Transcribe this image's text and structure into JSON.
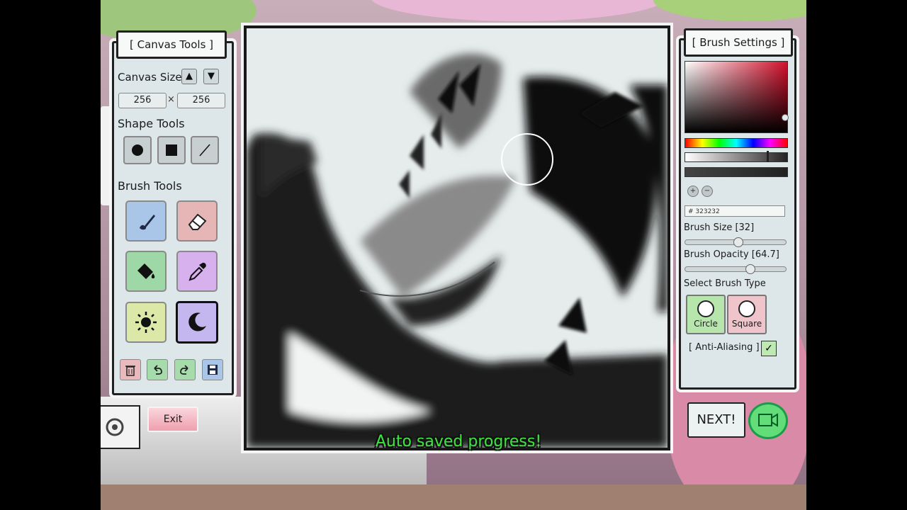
{
  "canvas_tools": {
    "title": "[ Canvas Tools ]",
    "canvas_size_label": "Canvas Size",
    "width": "256",
    "height": "256",
    "times": "×",
    "shape_tools_label": "Shape Tools",
    "shapes": [
      "circle-icon",
      "square-icon",
      "line-icon"
    ],
    "brush_tools_label": "Brush Tools",
    "tools": [
      {
        "name": "brush-icon",
        "color": "#a9c6e8"
      },
      {
        "name": "eraser-icon",
        "color": "#e6b6b7"
      },
      {
        "name": "bucket-icon",
        "color": "#9ed8a6"
      },
      {
        "name": "eyedropper-icon",
        "color": "#d7b0ee"
      },
      {
        "name": "brighten-icon",
        "color": "#dbe8a8"
      },
      {
        "name": "darken-icon",
        "color": "#c4b6ef",
        "selected": true
      }
    ],
    "actions": [
      {
        "name": "trash-icon",
        "color": "#eab9be"
      },
      {
        "name": "undo-icon",
        "color": "#a6dcab"
      },
      {
        "name": "redo-icon",
        "color": "#a6dcab"
      },
      {
        "name": "save-icon",
        "color": "#a9c6e8"
      }
    ]
  },
  "brush_settings": {
    "title": "[ Brush Settings ]",
    "hex_value": "# 323232",
    "brush_size_label": "Brush Size [32]",
    "brush_opacity_label": "Brush Opacity [64.7]",
    "select_type_label": "Select Brush Type",
    "types": [
      {
        "label": "Circle",
        "color": "#b7e6ad"
      },
      {
        "label": "Square",
        "color": "#efc5cb"
      }
    ],
    "anti_aliasing_label": "[ Anti-Aliasing ]",
    "anti_aliasing_checked": "✓"
  },
  "exit_label": "Exit",
  "next_label": "NEXT!",
  "status_message": "Auto saved progress!"
}
